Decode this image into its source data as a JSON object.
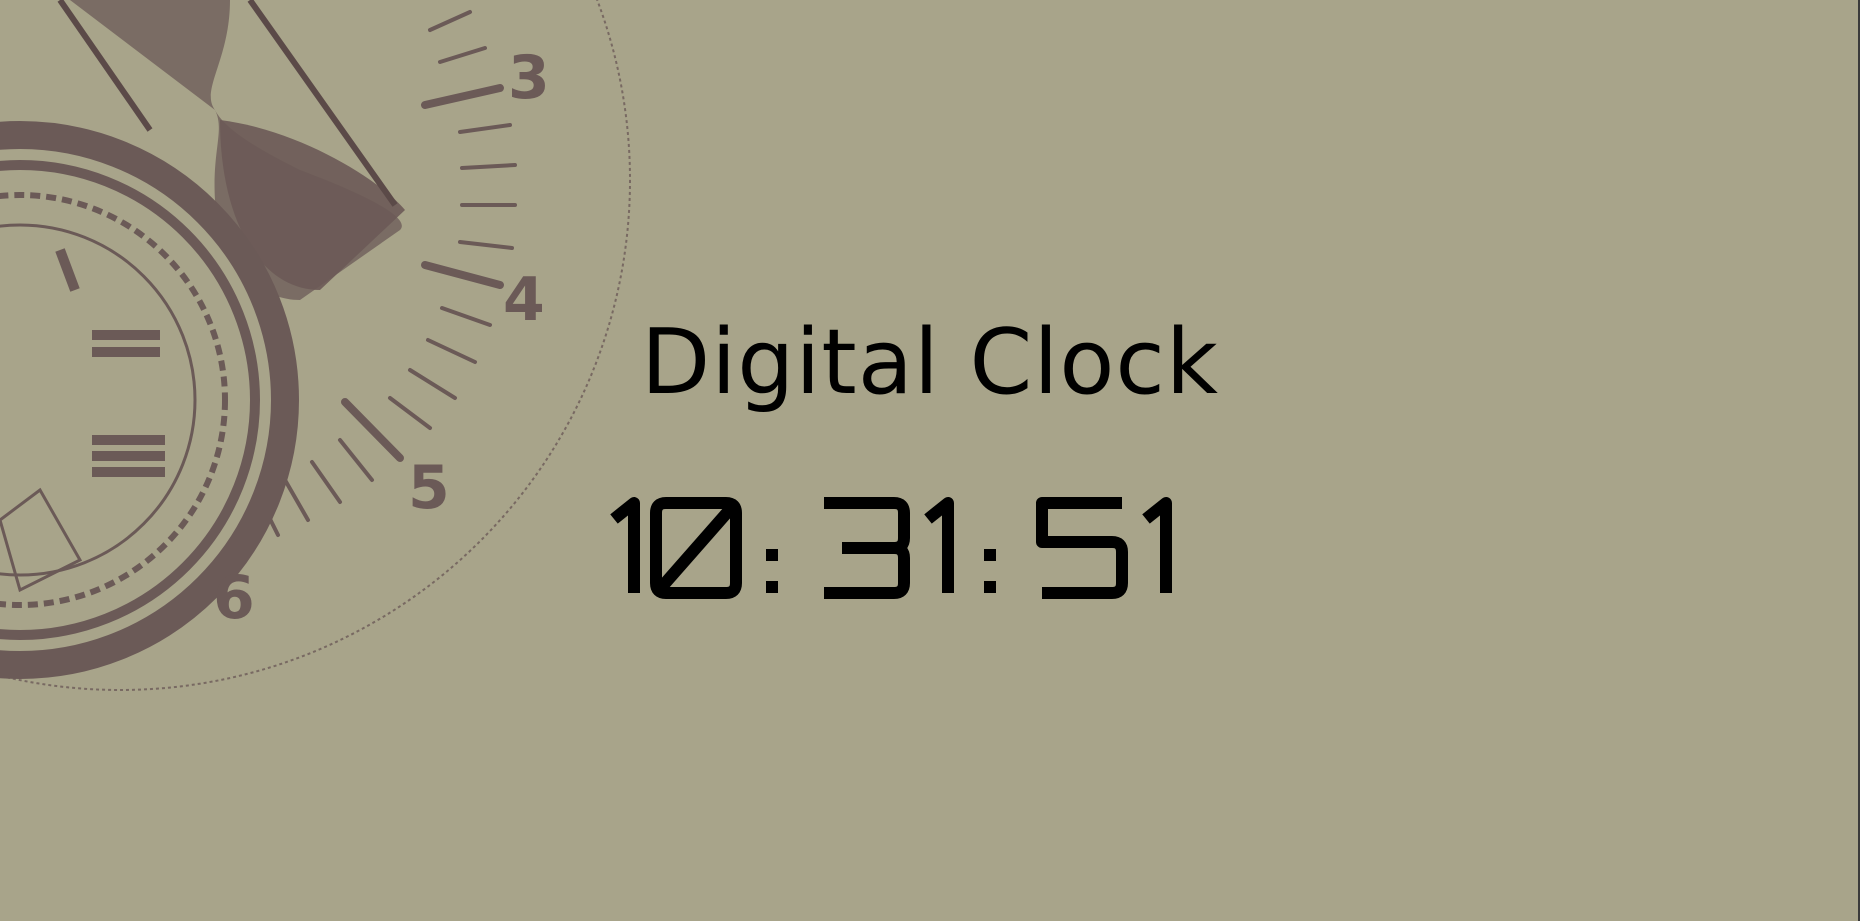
{
  "title": "Digital Clock",
  "time": {
    "hours": "10",
    "minutes": "31",
    "seconds": "51",
    "separator": ":"
  },
  "decor": {
    "dial_numerals": [
      "3",
      "4",
      "5",
      "6"
    ],
    "roman_numerals": [
      "I",
      "II",
      "III"
    ]
  },
  "colors": {
    "background": "#a8a48a",
    "artwork": "#6b5a57",
    "text": "#000000"
  }
}
